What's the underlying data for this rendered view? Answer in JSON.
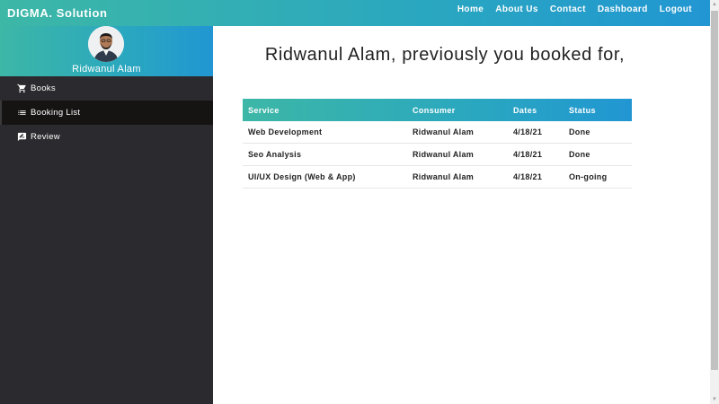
{
  "navbar": {
    "brand": "DIGMA. Solution",
    "links": [
      "Home",
      "About Us",
      "Contact",
      "Dashboard",
      "Logout"
    ]
  },
  "sidebar": {
    "user_name": "Ridwanul Alam",
    "items": [
      {
        "label": "Books",
        "icon": "cart-icon"
      },
      {
        "label": "Booking List",
        "icon": "list-icon"
      },
      {
        "label": "Review",
        "icon": "rate-review-icon"
      }
    ],
    "active_item": "Booking List"
  },
  "main": {
    "heading": "Ridwanul Alam, previously you booked for,",
    "table": {
      "headers": [
        "Service",
        "Consumer",
        "Dates",
        "Status"
      ],
      "rows": [
        [
          "Web Development",
          "Ridwanul Alam",
          "4/18/21",
          "Done"
        ],
        [
          "Seo Analysis",
          "Ridwanul Alam",
          "4/18/21",
          "Done"
        ],
        [
          "UI/UX Design (Web & App)",
          "Ridwanul Alam",
          "4/18/21",
          "On-going"
        ]
      ]
    }
  },
  "colors": {
    "gradient_start": "#3db7a6",
    "gradient_end": "#2196d2",
    "sidebar_bg": "#2b2a2e",
    "active_item_bg": "#161313"
  }
}
